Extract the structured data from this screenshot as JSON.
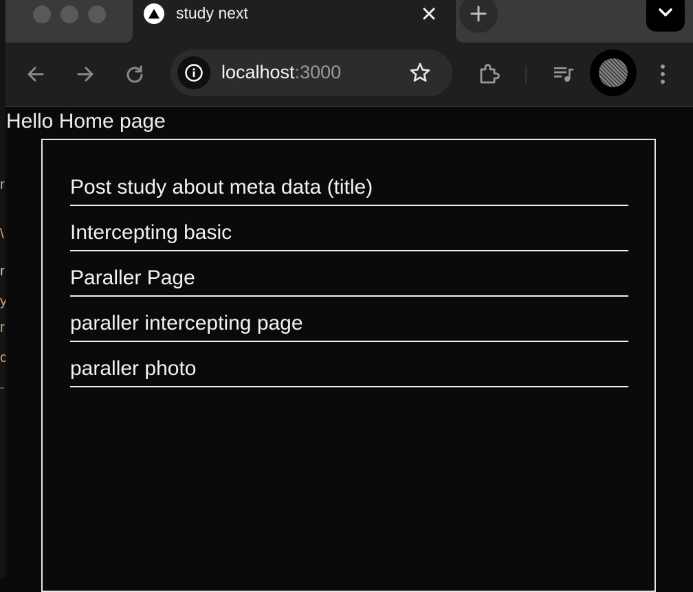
{
  "browser": {
    "tab": {
      "title": "study next"
    },
    "address": {
      "host": "localhost",
      "port": ":3000"
    },
    "icons": [
      "back-icon",
      "forward-icon",
      "reload-icon",
      "info-icon",
      "star-icon",
      "extensions-icon",
      "media-icon",
      "menu-icon"
    ]
  },
  "page": {
    "greeting": "Hello Home page",
    "links": [
      {
        "label": "Post study about meta data (title)"
      },
      {
        "label": "Intercepting basic"
      },
      {
        "label": "Paraller Page"
      },
      {
        "label": "paraller intercepting page"
      },
      {
        "label": "paraller photo"
      }
    ]
  },
  "colors": {
    "background": "#0a0a0a",
    "text": "#f2f2f2",
    "border": "#e6e6e6"
  }
}
